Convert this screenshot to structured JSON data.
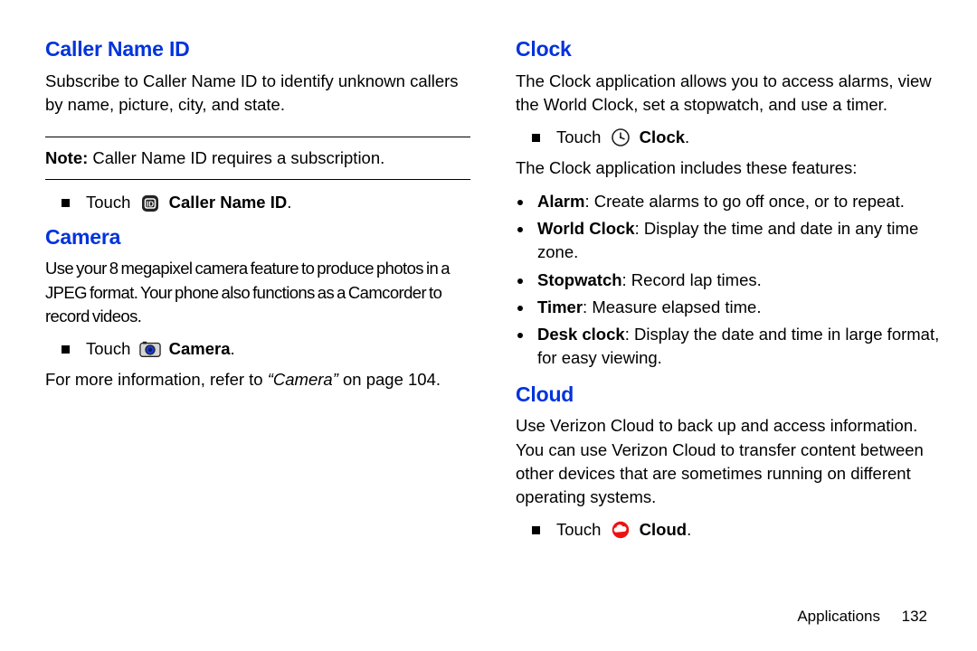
{
  "left": {
    "caller_id": {
      "heading": "Caller Name ID",
      "para": "Subscribe to Caller Name ID to identify unknown callers by name, picture, city, and state.",
      "note_label": "Note:",
      "note_text": " Caller Name ID requires a subscription.",
      "touch_pre": "Touch ",
      "touch_bold": "Caller Name ID",
      "touch_post": "."
    },
    "camera": {
      "heading": "Camera",
      "para": "Use your 8 megapixel camera feature to produce photos in a JPEG format. Your phone also functions as a Camcorder to record videos.",
      "touch_pre": "Touch ",
      "touch_bold": "Camera",
      "touch_post": ".",
      "ref_pre": "For more information, refer to ",
      "ref_ital": "“Camera”",
      "ref_post": " on page 104."
    }
  },
  "right": {
    "clock": {
      "heading": "Clock",
      "para": "The Clock application allows you to access alarms, view the World Clock, set a stopwatch, and use a timer.",
      "touch_pre": "Touch ",
      "touch_bold": "Clock",
      "touch_post": ".",
      "feat_intro": "The Clock application includes these features:",
      "features": [
        {
          "b": "Alarm",
          "t": ": Create alarms to go off once, or to repeat."
        },
        {
          "b": "World Clock",
          "t": ": Display the time and date in any time zone."
        },
        {
          "b": "Stopwatch",
          "t": ": Record lap times."
        },
        {
          "b": "Timer",
          "t": ": Measure elapsed time."
        },
        {
          "b": "Desk clock",
          "t": ": Display the date and time in large format, for easy viewing."
        }
      ]
    },
    "cloud": {
      "heading": "Cloud",
      "para": "Use Verizon Cloud to back up and access information. You can use Verizon Cloud to transfer content between other devices that are sometimes running on different operating systems.",
      "touch_pre": "Touch ",
      "touch_bold": "Cloud",
      "touch_post": "."
    }
  },
  "footer": {
    "section": "Applications",
    "page": "132"
  }
}
